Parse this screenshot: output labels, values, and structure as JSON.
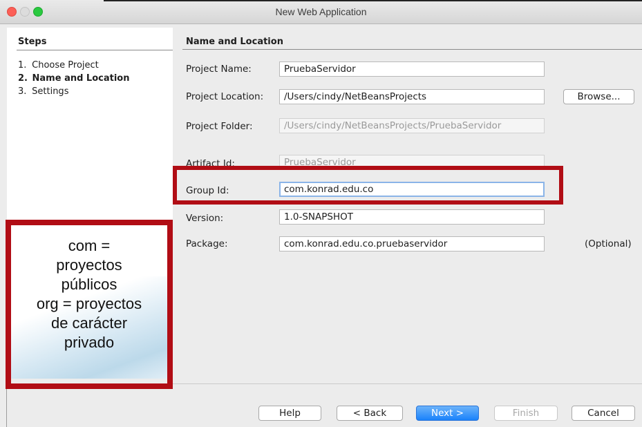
{
  "window": {
    "title": "New Web Application"
  },
  "steps": {
    "heading": "Steps",
    "items": [
      {
        "num": "1.",
        "label": "Choose Project"
      },
      {
        "num": "2.",
        "label": "Name and Location"
      },
      {
        "num": "3.",
        "label": "Settings"
      }
    ],
    "active_index": 1
  },
  "form": {
    "heading": "Name and Location",
    "project_name_label": "Project Name:",
    "project_name_value": "PruebaServidor",
    "project_location_label": "Project Location:",
    "project_location_value": "/Users/cindy/NetBeansProjects",
    "browse_label": "Browse...",
    "project_folder_label": "Project Folder:",
    "project_folder_value": "/Users/cindy/NetBeansProjects/PruebaServidor",
    "artifact_id_label": "Artifact Id:",
    "artifact_id_value": "PruebaServidor",
    "group_id_label": "Group Id:",
    "group_id_value": "com.konrad.edu.co",
    "version_label": "Version:",
    "version_value": "1.0-SNAPSHOT",
    "package_label": "Package:",
    "package_value": "com.konrad.edu.co.pruebaservidor",
    "optional_label": "(Optional)"
  },
  "buttons": {
    "help": "Help",
    "back": "< Back",
    "next": "Next >",
    "finish": "Finish",
    "cancel": "Cancel"
  },
  "annotation": {
    "lines": [
      "com =",
      "proyectos",
      "públicos",
      "org = proyectos",
      "de carácter",
      "privado"
    ],
    "color": "#b10d15"
  },
  "colors": {
    "accent": "#1a82fb",
    "callout": "#b10d15"
  }
}
